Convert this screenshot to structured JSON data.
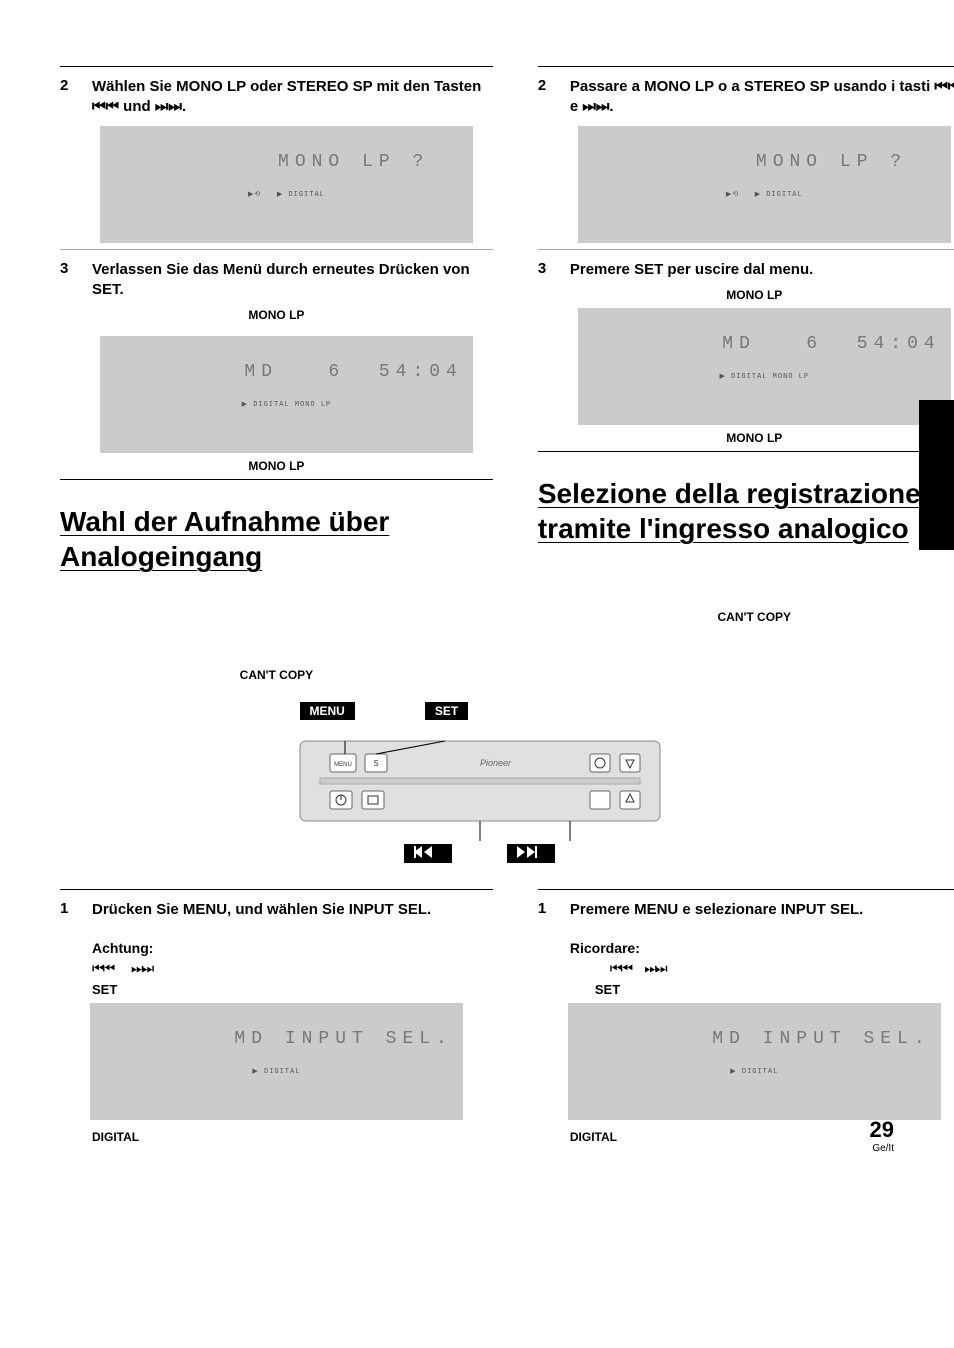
{
  "left": {
    "step2": {
      "num": "2",
      "text": "Wählen Sie MONO LP oder STEREO SP mit den Tasten ⏮⏮ und ⏭⏭."
    },
    "lcd1": "MONO LP ?",
    "lcd1_sub": "▶⟲   ▶ DIGITAL",
    "step3": {
      "num": "3",
      "text": "Verlassen Sie das Menü durch erneutes Drücken von SET."
    },
    "caption_lp_top": "MONO LP",
    "lcd2": "MD   6  54:04",
    "lcd2_sub": "▶ DIGITAL MONO LP",
    "caption_lp_bottom": "MONO LP",
    "heading": "Wahl der Aufnahme über Analogeingang",
    "cant_copy": "CAN'T COPY",
    "stepA1": {
      "num": "1",
      "text": "Drücken Sie MENU, und wählen Sie INPUT SEL."
    },
    "achtung": "Achtung:",
    "set": "SET",
    "lcd3": "MD INPUT SEL.",
    "lcd3_sub": "▶ DIGITAL",
    "digital": "DIGITAL"
  },
  "right": {
    "step2": {
      "num": "2",
      "text": "Passare a MONO LP o a STEREO SP usando i tasti ⏮⏮ e ⏭⏭."
    },
    "lcd1": "MONO LP ?",
    "lcd1_sub": "▶⟲   ▶ DIGITAL",
    "step3": {
      "num": "3",
      "text": "Premere SET per uscire dal menu."
    },
    "caption_lp_top": "MONO LP",
    "lcd2": "MD   6  54:04",
    "lcd2_sub": "▶ DIGITAL MONO LP",
    "caption_lp_bottom": "MONO LP",
    "heading": "Selezione della registrazione tramite l'ingresso analogico",
    "cant_copy": "CAN'T COPY",
    "stepA1": {
      "num": "1",
      "text": "Premere MENU e selezionare INPUT SEL."
    },
    "ricordare": "Ricordare:",
    "set": "SET",
    "lcd3": "MD INPUT SEL.",
    "lcd3_sub": "▶ DIGITAL",
    "digital": "DIGITAL"
  },
  "remote": {
    "menu_label": "MENU",
    "set_label": "SET",
    "skip_prev": "⏮⏮",
    "skip_next": "⏭⏭"
  },
  "page_number": "29",
  "lang_code": "Ge/It"
}
